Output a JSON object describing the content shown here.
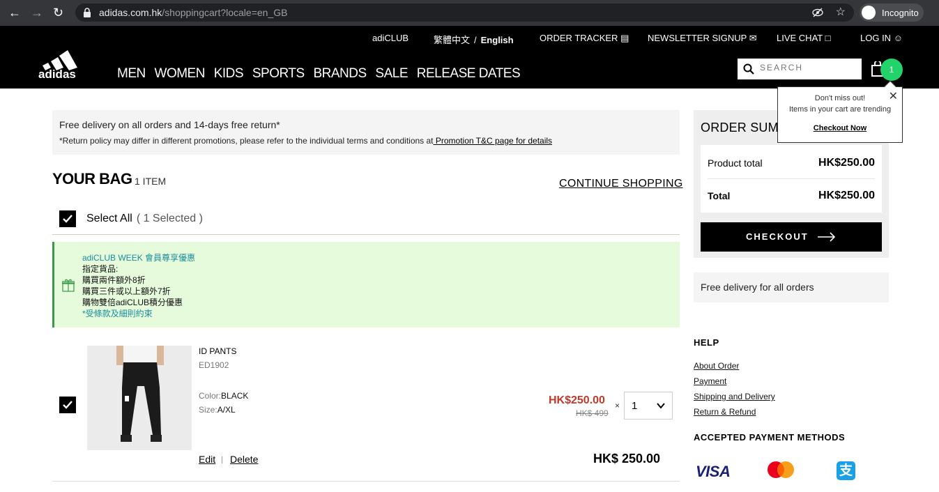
{
  "browser": {
    "url_domain": "adidas.com.hk",
    "url_path": "/shoppingcart?locale=en_GB",
    "profile_label": "Incognito"
  },
  "topnav": {
    "adiclub": "adiCLUB",
    "lang_zh": "繁體中文",
    "lang_sep": "/",
    "lang_en": "English",
    "order_tracker": "ORDER TRACKER",
    "newsletter": "NEWSLETTER SIGNUP",
    "live_chat": "LIVE CHAT",
    "login": "LOG IN"
  },
  "mainnav": {
    "items": [
      "MEN",
      "WOMEN",
      "KIDS",
      "SPORTS",
      "BRANDS",
      "SALE",
      "RELEASE DATES"
    ]
  },
  "search": {
    "placeholder": "SEARCH"
  },
  "cart_count": "1",
  "promo": {
    "line1": "Free delivery on all orders and 14-days free return*",
    "line2": "*Return policy may differ in different promotions, please refer to the individual terms and conditions at",
    "link": " Promotion T&C page for details"
  },
  "bag": {
    "title": "YOUR BAG",
    "count": "1 ITEM",
    "continue": "CONTINUE SHOPPING",
    "select_all": "Select All",
    "selected": "( 1 Selected )"
  },
  "adiclub_promo": {
    "title": "adiCLUB WEEK 會員尊享優惠",
    "l2": "指定貨品:",
    "l3": "購買兩件額外8折",
    "l4": "購買三件或以上額外7折",
    "l5": "購物雙倍adiCLUB積分優惠",
    "terms": "*受條款及細則約束"
  },
  "item": {
    "name": "ID PANTS",
    "code": "ED1902",
    "color_label": "Color:",
    "color": "BLACK",
    "size_label": "Size:",
    "size": "A/XL",
    "sale_price": "HK$250.00",
    "orig_price": "HK$ 499",
    "times": "×",
    "qty": "1",
    "line_total": "HK$ 250.00",
    "edit": "Edit",
    "delete": "Delete"
  },
  "summary": {
    "title": "ORDER SUMMARY",
    "product_total_label": "Product total",
    "product_total": "HK$250.00",
    "total_label": "Total",
    "total": "HK$250.00",
    "checkout": "CHECKOUT"
  },
  "free_delivery": "Free delivery for all orders",
  "help": {
    "title": "HELP",
    "links": [
      "About Order",
      "Payment",
      "Shipping and Delivery",
      "Return & Refund"
    ]
  },
  "payment": {
    "title": "ACCEPTED PAYMENT METHODS",
    "visa": "VISA"
  },
  "tooltip": {
    "line1": "Don't miss out!",
    "line2": "Items in your cart are trending",
    "cta": "Checkout Now"
  },
  "colors": {
    "accent_green": "#21d36a",
    "sale_red": "#c0392b",
    "promo_bg": "#e6fbdc"
  }
}
